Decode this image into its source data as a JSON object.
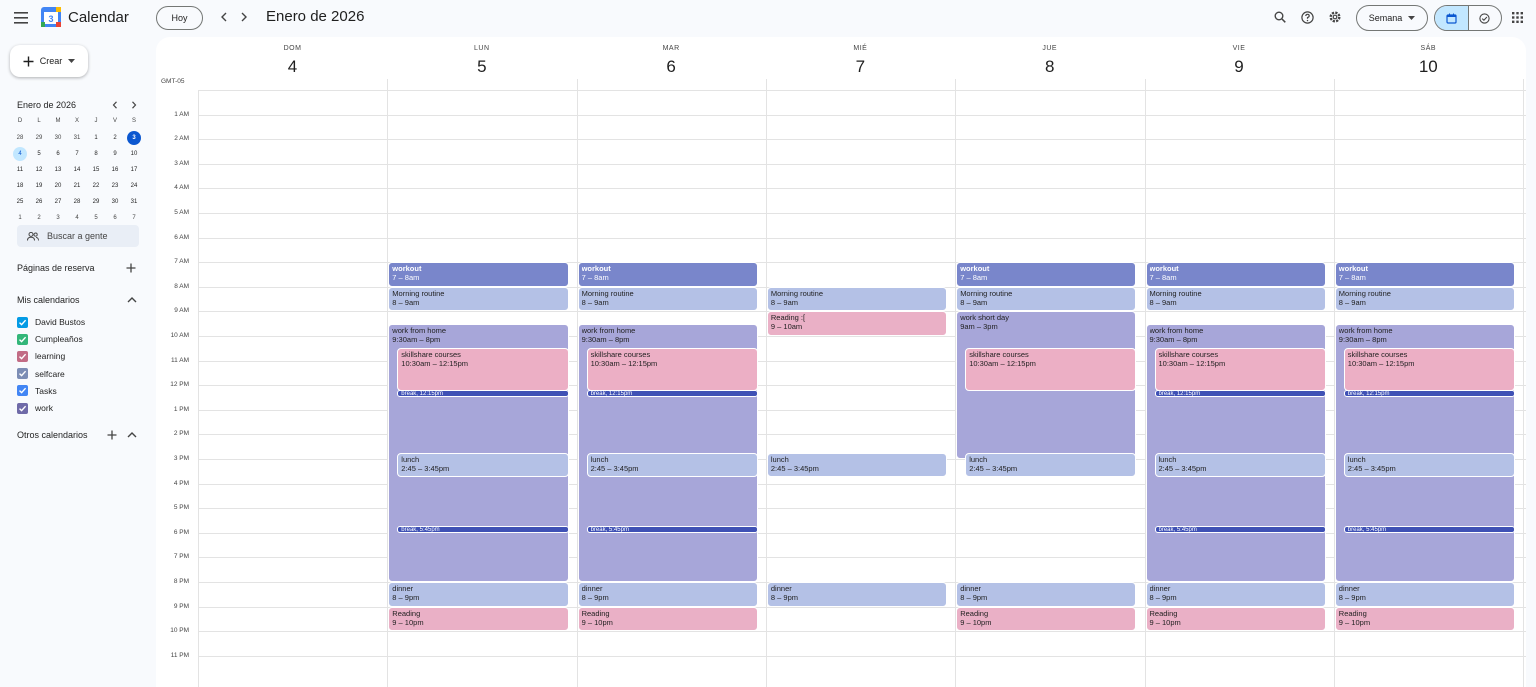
{
  "header": {
    "app_name": "Calendar",
    "today_label": "Hoy",
    "date_range": "Enero de 2026",
    "view_label": "Semana"
  },
  "sidebar": {
    "create_label": "Crear",
    "mini_title": "Enero de 2026",
    "weekday_headers": [
      "D",
      "L",
      "M",
      "X",
      "J",
      "V",
      "S"
    ],
    "mini_weeks": [
      [
        "28",
        "29",
        "30",
        "31",
        "1",
        "2",
        "3"
      ],
      [
        "4",
        "5",
        "6",
        "7",
        "8",
        "9",
        "10"
      ],
      [
        "11",
        "12",
        "13",
        "14",
        "15",
        "16",
        "17"
      ],
      [
        "18",
        "19",
        "20",
        "21",
        "22",
        "23",
        "24"
      ],
      [
        "25",
        "26",
        "27",
        "28",
        "29",
        "30",
        "31"
      ],
      [
        "1",
        "2",
        "3",
        "4",
        "5",
        "6",
        "7"
      ]
    ],
    "people_search_placeholder": "Buscar a gente",
    "booking_pages_label": "Páginas de reserva",
    "my_calendars_label": "Mis calendarios",
    "calendars": [
      {
        "name": "David Bustos",
        "color": "#039be5"
      },
      {
        "name": "Cumpleaños",
        "color": "#33b679"
      },
      {
        "name": "learning",
        "color": "#c26c85"
      },
      {
        "name": "selfcare",
        "color": "#7c8db5"
      },
      {
        "name": "Tasks",
        "color": "#4285f4"
      },
      {
        "name": "work",
        "color": "#6f6aa8"
      }
    ],
    "other_calendars_label": "Otros calendarios"
  },
  "week": {
    "timezone": "GMT-05",
    "days": [
      {
        "name": "DOM",
        "num": "4"
      },
      {
        "name": "LUN",
        "num": "5"
      },
      {
        "name": "MAR",
        "num": "6"
      },
      {
        "name": "MIÉ",
        "num": "7"
      },
      {
        "name": "JUE",
        "num": "8"
      },
      {
        "name": "VIE",
        "num": "9"
      },
      {
        "name": "SÁB",
        "num": "10"
      }
    ],
    "hours": [
      "1 AM",
      "2 AM",
      "3 AM",
      "4 AM",
      "5 AM",
      "6 AM",
      "7 AM",
      "8 AM",
      "9 AM",
      "10 AM",
      "11 AM",
      "12 PM",
      "1 PM",
      "2 PM",
      "3 PM",
      "4 PM",
      "5 PM",
      "6 PM",
      "7 PM",
      "8 PM",
      "9 PM",
      "10 PM",
      "11 PM"
    ]
  },
  "events": [
    {
      "day": 1,
      "kind": "workout",
      "title": "workout",
      "time": "7 – 8am",
      "start": 7,
      "end": 8
    },
    {
      "day": 1,
      "kind": "morning",
      "title": "Morning routine",
      "time": "8 – 9am",
      "start": 8,
      "end": 9
    },
    {
      "day": 1,
      "kind": "work",
      "title": "work from home",
      "time": "9:30am – 8pm",
      "start": 9.5,
      "end": 20
    },
    {
      "day": 1,
      "kind": "skill",
      "title": "skillshare courses",
      "time": "10:30am – 12:15pm",
      "start": 10.5,
      "end": 12.25
    },
    {
      "day": 1,
      "kind": "break",
      "title": "break, 12:15pm",
      "time": "",
      "start": 12.25,
      "end": 12.5
    },
    {
      "day": 1,
      "kind": "lunch",
      "title": "lunch",
      "time": "2:45 – 3:45pm",
      "start": 14.75,
      "end": 15.75
    },
    {
      "day": 1,
      "kind": "break",
      "title": "break, 5:45pm",
      "time": "",
      "start": 17.75,
      "end": 18
    },
    {
      "day": 1,
      "kind": "dinner",
      "title": "dinner",
      "time": "8 – 9pm",
      "start": 20,
      "end": 21
    },
    {
      "day": 1,
      "kind": "reading",
      "title": "Reading",
      "time": "9 – 10pm",
      "start": 21,
      "end": 22
    },
    {
      "day": 2,
      "kind": "workout",
      "title": "workout",
      "time": "7 – 8am",
      "start": 7,
      "end": 8
    },
    {
      "day": 2,
      "kind": "morning",
      "title": "Morning routine",
      "time": "8 – 9am",
      "start": 8,
      "end": 9
    },
    {
      "day": 2,
      "kind": "work",
      "title": "work from home",
      "time": "9:30am – 8pm",
      "start": 9.5,
      "end": 20
    },
    {
      "day": 2,
      "kind": "skill",
      "title": "skillshare courses",
      "time": "10:30am – 12:15pm",
      "start": 10.5,
      "end": 12.25
    },
    {
      "day": 2,
      "kind": "break",
      "title": "break, 12:15pm",
      "time": "",
      "start": 12.25,
      "end": 12.5
    },
    {
      "day": 2,
      "kind": "lunch",
      "title": "lunch",
      "time": "2:45 – 3:45pm",
      "start": 14.75,
      "end": 15.75
    },
    {
      "day": 2,
      "kind": "break",
      "title": "break, 5:45pm",
      "time": "",
      "start": 17.75,
      "end": 18
    },
    {
      "day": 2,
      "kind": "dinner",
      "title": "dinner",
      "time": "8 – 9pm",
      "start": 20,
      "end": 21
    },
    {
      "day": 2,
      "kind": "reading",
      "title": "Reading",
      "time": "9 – 10pm",
      "start": 21,
      "end": 22
    },
    {
      "day": 3,
      "kind": "morning",
      "title": "Morning routine",
      "time": "8 – 9am",
      "start": 8,
      "end": 9
    },
    {
      "day": 3,
      "kind": "reading",
      "title": "Reading :[",
      "time": "9 – 10am",
      "start": 9,
      "end": 10
    },
    {
      "day": 3,
      "kind": "lunch",
      "title": "lunch",
      "time": "2:45 – 3:45pm",
      "start": 14.75,
      "end": 15.75
    },
    {
      "day": 3,
      "kind": "dinner",
      "title": "dinner",
      "time": "8 – 9pm",
      "start": 20,
      "end": 21
    },
    {
      "day": 4,
      "kind": "workout",
      "title": "workout",
      "time": "7 – 8am",
      "start": 7,
      "end": 8
    },
    {
      "day": 4,
      "kind": "morning",
      "title": "Morning routine",
      "time": "8 – 9am",
      "start": 8,
      "end": 9
    },
    {
      "day": 4,
      "kind": "work",
      "title": "work short day",
      "time": "9am – 3pm",
      "start": 9,
      "end": 15
    },
    {
      "day": 4,
      "kind": "skill",
      "title": "skillshare courses",
      "time": "10:30am – 12:15pm",
      "start": 10.5,
      "end": 12.25
    },
    {
      "day": 4,
      "kind": "lunch",
      "title": "lunch",
      "time": "2:45 – 3:45pm",
      "start": 14.75,
      "end": 15.75
    },
    {
      "day": 4,
      "kind": "dinner",
      "title": "dinner",
      "time": "8 – 9pm",
      "start": 20,
      "end": 21
    },
    {
      "day": 4,
      "kind": "reading",
      "title": "Reading",
      "time": "9 – 10pm",
      "start": 21,
      "end": 22
    },
    {
      "day": 5,
      "kind": "workout",
      "title": "workout",
      "time": "7 – 8am",
      "start": 7,
      "end": 8
    },
    {
      "day": 5,
      "kind": "morning",
      "title": "Morning routine",
      "time": "8 – 9am",
      "start": 8,
      "end": 9
    },
    {
      "day": 5,
      "kind": "work",
      "title": "work from home",
      "time": "9:30am – 8pm",
      "start": 9.5,
      "end": 20
    },
    {
      "day": 5,
      "kind": "skill",
      "title": "skillshare courses",
      "time": "10:30am – 12:15pm",
      "start": 10.5,
      "end": 12.25
    },
    {
      "day": 5,
      "kind": "break",
      "title": "break, 12:15pm",
      "time": "",
      "start": 12.25,
      "end": 12.5
    },
    {
      "day": 5,
      "kind": "lunch",
      "title": "lunch",
      "time": "2:45 – 3:45pm",
      "start": 14.75,
      "end": 15.75
    },
    {
      "day": 5,
      "kind": "break",
      "title": "break, 5:45pm",
      "time": "",
      "start": 17.75,
      "end": 18
    },
    {
      "day": 5,
      "kind": "dinner",
      "title": "dinner",
      "time": "8 – 9pm",
      "start": 20,
      "end": 21
    },
    {
      "day": 5,
      "kind": "reading",
      "title": "Reading",
      "time": "9 – 10pm",
      "start": 21,
      "end": 22
    },
    {
      "day": 6,
      "kind": "workout",
      "title": "workout",
      "time": "7 – 8am",
      "start": 7,
      "end": 8
    },
    {
      "day": 6,
      "kind": "morning",
      "title": "Morning routine",
      "time": "8 – 9am",
      "start": 8,
      "end": 9
    },
    {
      "day": 6,
      "kind": "work",
      "title": "work from home",
      "time": "9:30am – 8pm",
      "start": 9.5,
      "end": 20
    },
    {
      "day": 6,
      "kind": "skill",
      "title": "skillshare courses",
      "time": "10:30am – 12:15pm",
      "start": 10.5,
      "end": 12.25
    },
    {
      "day": 6,
      "kind": "break",
      "title": "break, 12:15pm",
      "time": "",
      "start": 12.25,
      "end": 12.5
    },
    {
      "day": 6,
      "kind": "lunch",
      "title": "lunch",
      "time": "2:45 – 3:45pm",
      "start": 14.75,
      "end": 15.75
    },
    {
      "day": 6,
      "kind": "break",
      "title": "break, 5:45pm",
      "time": "",
      "start": 17.75,
      "end": 18
    },
    {
      "day": 6,
      "kind": "dinner",
      "title": "dinner",
      "time": "8 – 9pm",
      "start": 20,
      "end": 21
    },
    {
      "day": 6,
      "kind": "reading",
      "title": "Reading",
      "time": "9 – 10pm",
      "start": 21,
      "end": 22
    }
  ]
}
